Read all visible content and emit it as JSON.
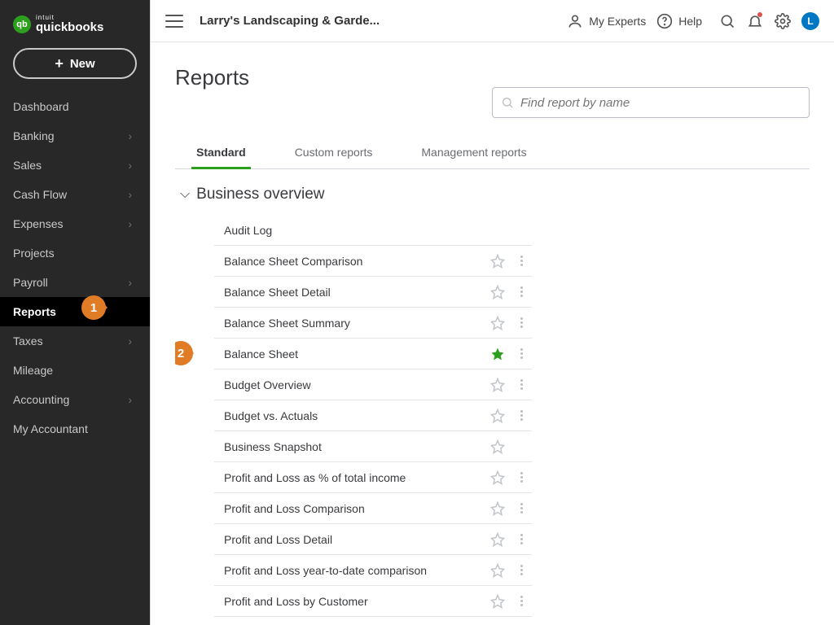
{
  "brand": {
    "short": "qb",
    "intuit": "intuit",
    "name": "quickbooks"
  },
  "new_button": "New",
  "sidebar": {
    "items": [
      {
        "label": "Dashboard",
        "chevron": false
      },
      {
        "label": "Banking",
        "chevron": true
      },
      {
        "label": "Sales",
        "chevron": true
      },
      {
        "label": "Cash Flow",
        "chevron": true
      },
      {
        "label": "Expenses",
        "chevron": true
      },
      {
        "label": "Projects",
        "chevron": false
      },
      {
        "label": "Payroll",
        "chevron": true
      },
      {
        "label": "Reports",
        "chevron": false,
        "active": true
      },
      {
        "label": "Taxes",
        "chevron": true
      },
      {
        "label": "Mileage",
        "chevron": false
      },
      {
        "label": "Accounting",
        "chevron": true
      },
      {
        "label": "My Accountant",
        "chevron": false
      }
    ]
  },
  "topbar": {
    "company": "Larry's Landscaping & Garde...",
    "my_experts": "My Experts",
    "help": "Help",
    "avatar_initial": "L"
  },
  "page": {
    "title": "Reports",
    "search_placeholder": "Find report by name"
  },
  "tabs": [
    {
      "label": "Standard",
      "active": true
    },
    {
      "label": "Custom reports",
      "active": false
    },
    {
      "label": "Management reports",
      "active": false
    }
  ],
  "section": {
    "title": "Business overview"
  },
  "reports": [
    {
      "name": "Audit Log",
      "star": false,
      "menu": false
    },
    {
      "name": "Balance Sheet Comparison",
      "star": true,
      "menu": true
    },
    {
      "name": "Balance Sheet Detail",
      "star": true,
      "menu": true
    },
    {
      "name": "Balance Sheet Summary",
      "star": true,
      "menu": true
    },
    {
      "name": "Balance Sheet",
      "star": true,
      "menu": true,
      "favorite": true,
      "callout": "2"
    },
    {
      "name": "Budget Overview",
      "star": true,
      "menu": true
    },
    {
      "name": "Budget vs. Actuals",
      "star": true,
      "menu": true
    },
    {
      "name": "Business Snapshot",
      "star": true,
      "menu": false
    },
    {
      "name": "Profit and Loss as % of total income",
      "star": true,
      "menu": true
    },
    {
      "name": "Profit and Loss Comparison",
      "star": true,
      "menu": true
    },
    {
      "name": "Profit and Loss Detail",
      "star": true,
      "menu": true
    },
    {
      "name": "Profit and Loss year-to-date comparison",
      "star": true,
      "menu": true
    },
    {
      "name": "Profit and Loss by Customer",
      "star": true,
      "menu": true
    }
  ],
  "callouts": {
    "one": "1",
    "two": "2"
  }
}
